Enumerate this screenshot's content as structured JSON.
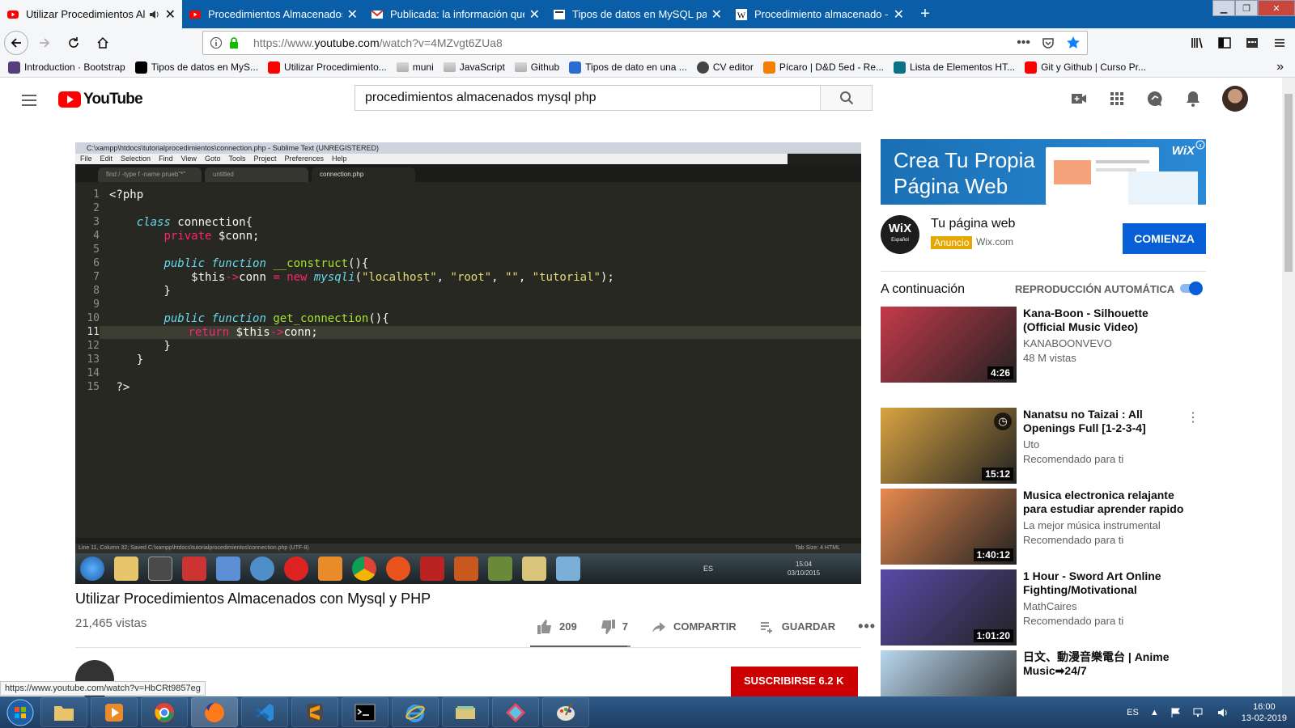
{
  "browser": {
    "tabs": [
      {
        "title": "Utilizar Procedimientos Almacenados",
        "icon": "youtube-icon",
        "active": true,
        "audio": true
      },
      {
        "title": "Procedimientos Almacenados",
        "icon": "youtube-icon",
        "active": false
      },
      {
        "title": "Publicada: la información que",
        "icon": "gmail-icon",
        "active": false
      },
      {
        "title": "Tipos de datos en MySQL para",
        "icon": "page-icon",
        "active": false
      },
      {
        "title": "Procedimiento almacenado - W",
        "icon": "wikipedia-icon",
        "active": false
      }
    ],
    "new_tab": "+",
    "url": {
      "prefix": "https://www.",
      "host": "youtube.com",
      "path": "/watch?v=4MZvgt6ZUa8"
    },
    "bookmarks": [
      {
        "label": "Introduction · Bootstrap",
        "icon": "bootstrap-icon",
        "color": "#563d7c"
      },
      {
        "label": "Tipos de datos en MyS...",
        "icon": "ah-icon",
        "color": "#000000"
      },
      {
        "label": "Utilizar Procedimiento...",
        "icon": "youtube-icon",
        "color": "#ff0000"
      },
      {
        "label": "muni",
        "icon": "folder-icon",
        "color": "#8a8a8a"
      },
      {
        "label": "JavaScript",
        "icon": "folder-icon",
        "color": "#8a8a8a"
      },
      {
        "label": "Github",
        "icon": "folder-icon",
        "color": "#8a8a8a"
      },
      {
        "label": "Tipos de dato en una ...",
        "icon": "shield-icon",
        "color": "#2a6cd0"
      },
      {
        "label": "CV editor",
        "icon": "globe-icon",
        "color": "#444444"
      },
      {
        "label": "Pícaro | D&D 5ed - Re...",
        "icon": "blogger-icon",
        "color": "#f57d00"
      },
      {
        "label": "Lista de Elementos HT...",
        "icon": "star-icon",
        "color": "#0b7285"
      },
      {
        "label": "Git y Github | Curso Pr...",
        "icon": "youtube-icon",
        "color": "#ff0000"
      }
    ],
    "status_url": "https://www.youtube.com/watch?v=HbCRt9857eg"
  },
  "youtube": {
    "logo_text": "YouTube",
    "search_query": "procedimientos almacenados mysql php",
    "video": {
      "title": "Utilizar Procedimientos Almacenados con Mysql y PHP",
      "views": "21,465 vistas",
      "likes": "209",
      "dislikes": "7",
      "like_ratio": 0.97,
      "share": "COMPARTIR",
      "save": "GUARDAR",
      "subscribe": "SUSCRIBIRSE  6.2 K"
    },
    "editor": {
      "window_title": "C:\\xampp\\htdocs\\tutorialprocedimientos\\connection.php - Sublime Text (UNREGISTERED)",
      "menu": [
        "File",
        "Edit",
        "Selection",
        "Find",
        "View",
        "Goto",
        "Tools",
        "Project",
        "Preferences",
        "Help"
      ],
      "tabs": [
        "find / -type f -name prueb\"*\"",
        "untitled",
        "connection.php"
      ],
      "status": "Line 11, Column 32; Saved C:\\xampp\\htdocs\\tutorialprocedimientos\\connection.php (UTF-8)",
      "status_right": "Tab Size: 4      HTML",
      "taskbar_time": "15:04",
      "taskbar_date": "03/10/2015",
      "taskbar_lang": "ES",
      "line_numbers": [
        "1",
        "2",
        "3",
        "4",
        "5",
        "6",
        "7",
        "8",
        "9",
        "10",
        "11",
        "12",
        "13",
        "14",
        "15"
      ]
    },
    "ad": {
      "headline": "Crea Tu Propia Página Web",
      "brand": "WiX",
      "logo": "WiX",
      "logo_sub": "Español",
      "title": "Tu página web",
      "badge": "Anuncio",
      "domain": "Wix.com",
      "cta": "COMIENZA"
    },
    "up_next_label": "A continuación",
    "autoplay_label": "REPRODUCCIÓN AUTOMÁTICA",
    "autoplay_on": true,
    "related": [
      {
        "title": "Kana-Boon - Silhouette (Official Music Video)",
        "channel": "KANABOONVEVO",
        "meta": "48 M vistas",
        "duration": "4:26",
        "thumb_color": "#c43a4a"
      },
      {
        "title": "Nanatsu no Taizai : All Openings Full [1-2-3-4]",
        "channel": "Uto",
        "meta": "Recomendado para ti",
        "duration": "15:12",
        "thumb_color": "#d9a441"
      },
      {
        "title": "Musica electronica relajante para estudiar aprender rapido",
        "channel": "La mejor música instrumental",
        "meta": "Recomendado para ti",
        "duration": "1:40:12",
        "thumb_color": "#e88a4e"
      },
      {
        "title": "1 Hour - Sword Art Online Fighting/Motivational",
        "channel": "MathCaires",
        "meta": "Recomendado para ti",
        "duration": "1:01:20",
        "thumb_color": "#5a4aa8"
      },
      {
        "title": "日文、動漫音樂電台 | Anime Music➡24/7",
        "channel": "",
        "meta": "",
        "duration": "",
        "thumb_color": "#b9d7ee"
      }
    ]
  },
  "os": {
    "lang": "ES",
    "time": "16:00",
    "date": "13-02-2019"
  },
  "colors": {
    "youtube_red": "#ff0000",
    "accent_blue": "#065fd4",
    "firefox_tabbar": "#0a5ea8"
  }
}
